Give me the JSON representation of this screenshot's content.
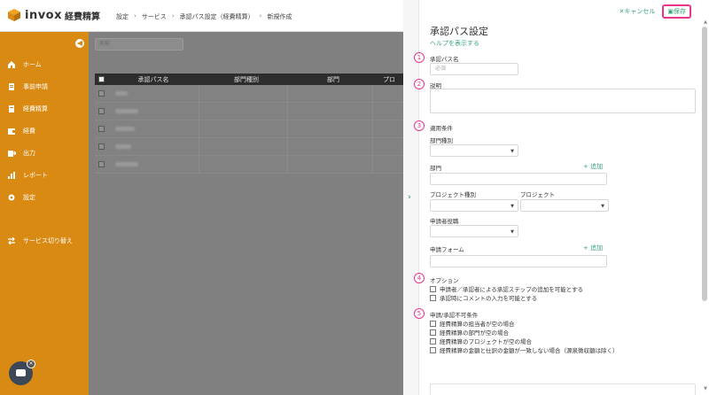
{
  "header": {
    "logo_text": "invox",
    "logo_sub": "経費精算",
    "breadcrumb": [
      "設定",
      "サービス",
      "承認パス設定（経費精算）",
      "新規作成"
    ]
  },
  "sidebar": {
    "items": [
      {
        "label": "ホーム",
        "icon": "home-icon"
      },
      {
        "label": "事前申請",
        "icon": "document-icon"
      },
      {
        "label": "経費精算",
        "icon": "receipt-icon"
      },
      {
        "label": "経費",
        "icon": "wallet-icon"
      },
      {
        "label": "出力",
        "icon": "export-icon"
      },
      {
        "label": "レポート",
        "icon": "chart-icon"
      },
      {
        "label": "設定",
        "icon": "gear-icon"
      },
      {
        "label": "サービス切り替え",
        "icon": "switch-icon"
      }
    ],
    "collapse_icon": "arrow-left-icon"
  },
  "main": {
    "search_placeholder": "名前",
    "table_headers": [
      "承認パス名",
      "部門種別",
      "部門",
      "プロ"
    ]
  },
  "drawer": {
    "cancel_label": "キャンセル",
    "save_label": "保存",
    "title": "承認パス設定",
    "help_link": "ヘルプを表示する",
    "path_name_label": "承認パス名",
    "path_name_placeholder": "必須",
    "description_label": "説明",
    "conditions_label": "適用条件",
    "dept_type_label": "部門種別",
    "dept_label": "部門",
    "add_label": "追加",
    "project_type_label": "プロジェクト種別",
    "project_label": "プロジェクト",
    "applicant_role_label": "申請者役職",
    "form_label": "申請フォーム",
    "options_label": "オプション",
    "options": [
      "申請者／承認者による承認ステップの追加を可能とする",
      "承認時にコメントの入力を可能とする"
    ],
    "skip_label": "申請/承認不可条件",
    "skip_conditions": [
      "経費精算の担当者が空の場合",
      "経費精算の部門が空の場合",
      "経費精算のプロジェクトが空の場合",
      "経費精算の金額と仕訳の金額が一致しない場合（源泉徴収額は除く）"
    ],
    "markers": [
      "1",
      "2",
      "3",
      "4",
      "5"
    ]
  },
  "colors": {
    "sidebar": "#d88a12",
    "accent_green": "#3aa57a",
    "highlight_pink": "#e8368f",
    "overlay_gray": "#808080"
  }
}
